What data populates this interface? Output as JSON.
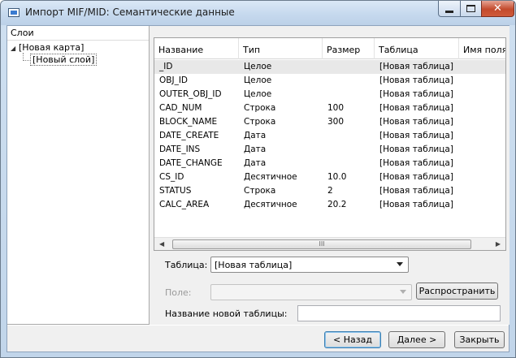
{
  "window": {
    "title": "Импорт MIF/MID: Семантические данные",
    "minimize_icon": "minimize-icon",
    "maximize_icon": "maximize-icon",
    "close_icon": "close-icon",
    "close_glyph": "✕"
  },
  "tree": {
    "header": "Слои",
    "root_label": "[Новая карта]",
    "child_label": "[Новый слой]"
  },
  "grid": {
    "columns": [
      "Название",
      "Тип",
      "Размер",
      "Таблица",
      "Имя поля"
    ],
    "rows": [
      [
        "_ID",
        "Целое",
        "",
        "[Новая таблица]",
        ""
      ],
      [
        "OBJ_ID",
        "Целое",
        "",
        "[Новая таблица]",
        ""
      ],
      [
        "OUTER_OBJ_ID",
        "Целое",
        "",
        "[Новая таблица]",
        ""
      ],
      [
        "CAD_NUM",
        "Строка",
        "100",
        "[Новая таблица]",
        ""
      ],
      [
        "BLOCK_NAME",
        "Строка",
        "300",
        "[Новая таблица]",
        ""
      ],
      [
        "DATE_CREATE",
        "Дата",
        "",
        "[Новая таблица]",
        ""
      ],
      [
        "DATE_INS",
        "Дата",
        "",
        "[Новая таблица]",
        ""
      ],
      [
        "DATE_CHANGE",
        "Дата",
        "",
        "[Новая таблица]",
        ""
      ],
      [
        "CS_ID",
        "Десятичное",
        "10.0",
        "[Новая таблица]",
        ""
      ],
      [
        "STATUS",
        "Строка",
        "2",
        "[Новая таблица]",
        ""
      ],
      [
        "CALC_AREA",
        "Десятичное",
        "20.2",
        "[Новая таблица]",
        ""
      ]
    ],
    "scroll_grip": "III"
  },
  "form": {
    "table_label": "Таблица:",
    "table_value": "[Новая таблица]",
    "field_label": "Поле:",
    "field_value": "",
    "spread_button": "Распространить",
    "new_table_label": "Название новой таблицы:",
    "new_table_value": ""
  },
  "footer": {
    "back_button": "< Назад",
    "next_button": "Далее >",
    "close_button": "Закрыть"
  }
}
